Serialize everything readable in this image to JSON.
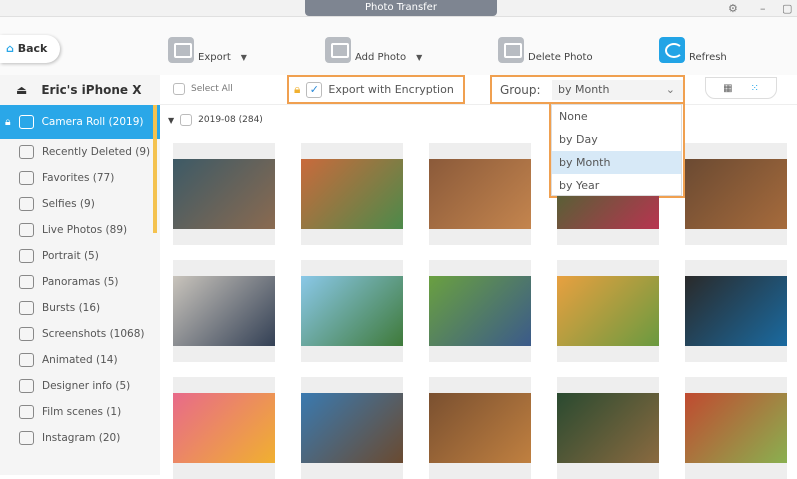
{
  "window": {
    "title": "Photo Transfer"
  },
  "toolbar": {
    "back": "Back",
    "export": "Export",
    "add_photo": "Add Photo",
    "delete_photo": "Delete Photo",
    "refresh": "Refresh"
  },
  "device": {
    "name": "Eric's iPhone X"
  },
  "sidebar": {
    "items": [
      {
        "label": "Camera Roll (2019)"
      },
      {
        "label": "Recently Deleted (9)"
      },
      {
        "label": "Favorites (77)"
      },
      {
        "label": "Selfies (9)"
      },
      {
        "label": "Live Photos (89)"
      },
      {
        "label": "Portrait (5)"
      },
      {
        "label": "Panoramas (5)"
      },
      {
        "label": "Bursts (16)"
      },
      {
        "label": "Screenshots (1068)"
      },
      {
        "label": "Animated (14)"
      },
      {
        "label": "Designer info (5)"
      },
      {
        "label": "Film scenes (1)"
      },
      {
        "label": "Instagram (20)"
      }
    ]
  },
  "header": {
    "select_all": "Select All",
    "export_encryption": "Export with Encryption",
    "group_label": "Group:",
    "group_value": "by Month"
  },
  "group_options": [
    "None",
    "by Day",
    "by Month",
    "by Year"
  ],
  "section": {
    "label": "2019-08 (284)"
  },
  "photos": [
    {
      "colors": [
        "#3d5a66",
        "#8a6a50"
      ]
    },
    {
      "colors": [
        "#c96a3c",
        "#4c8a4a"
      ]
    },
    {
      "colors": [
        "#8b5a3a",
        "#c4854e"
      ]
    },
    {
      "colors": [
        "#3f6b2f",
        "#b83450"
      ]
    },
    {
      "colors": [
        "#6b4a32",
        "#a66b3c"
      ]
    },
    {
      "colors": [
        "#c9c4bc",
        "#334055"
      ]
    },
    {
      "colors": [
        "#8ac8e8",
        "#3f7a3a"
      ]
    },
    {
      "colors": [
        "#6aa040",
        "#3b5a8a"
      ]
    },
    {
      "colors": [
        "#e8a040",
        "#6a9a40"
      ]
    },
    {
      "colors": [
        "#2a2a2a",
        "#1a6aa0"
      ]
    },
    {
      "colors": [
        "#e86a8a",
        "#f0b030"
      ]
    },
    {
      "colors": [
        "#3a7ab0",
        "#6a4a30"
      ]
    },
    {
      "colors": [
        "#7a5030",
        "#c08040"
      ]
    },
    {
      "colors": [
        "#2a4a30",
        "#8a6a40"
      ]
    },
    {
      "colors": [
        "#c04a30",
        "#8ab050"
      ]
    }
  ]
}
